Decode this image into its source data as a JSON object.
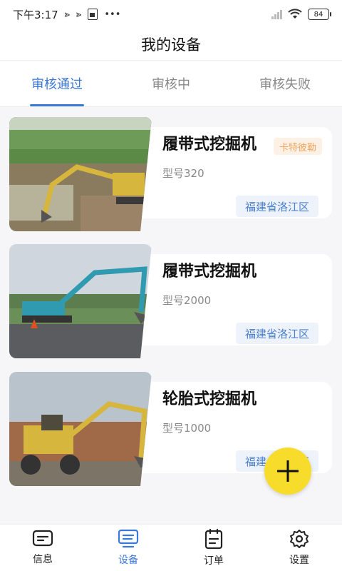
{
  "status_bar": {
    "time": "下午3:17",
    "battery": "84"
  },
  "header": {
    "title": "我的设备"
  },
  "tabs": [
    {
      "label": "审核通过",
      "active": true
    },
    {
      "label": "审核中",
      "active": false
    },
    {
      "label": "审核失败",
      "active": false
    }
  ],
  "devices": [
    {
      "title": "履带式挖掘机",
      "badge": "卡特彼勒",
      "model": "型号320",
      "location": "福建省洛江区"
    },
    {
      "title": "履带式挖掘机",
      "badge": "",
      "model": "型号2000",
      "location": "福建省洛江区"
    },
    {
      "title": "轮胎式挖掘机",
      "badge": "",
      "model": "型号1000",
      "location": "福建省洛江区"
    }
  ],
  "fab": {
    "icon": "plus-icon"
  },
  "bottom_nav": [
    {
      "label": "信息",
      "icon": "message-icon",
      "active": false
    },
    {
      "label": "设备",
      "icon": "device-icon",
      "active": true
    },
    {
      "label": "订单",
      "icon": "order-icon",
      "active": false
    },
    {
      "label": "设置",
      "icon": "gear-icon",
      "active": false
    }
  ],
  "colors": {
    "accent": "#3b78d8",
    "fab": "#f7dc2c",
    "badge_bg": "#fdf0e4",
    "badge_text": "#f0a65e",
    "location_bg": "#eef3fb"
  }
}
